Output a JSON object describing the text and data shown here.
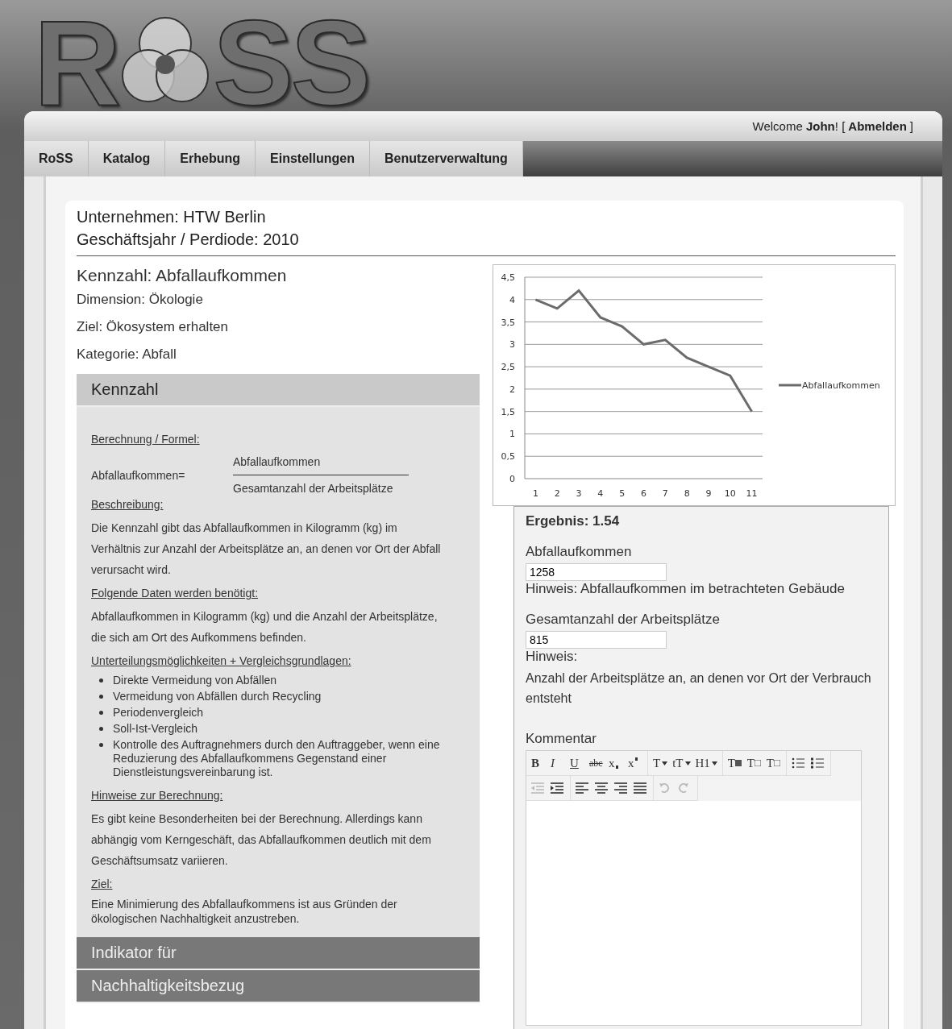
{
  "logo": {
    "before": "R",
    "after": "SS"
  },
  "user_bar": {
    "welcome": "Welcome **John**! [",
    "logout": "Abmelden",
    "close": "]"
  },
  "nav": [
    {
      "label": "RoSS",
      "selected": false
    },
    {
      "label": "Katalog",
      "selected": false
    },
    {
      "label": "Erhebung",
      "selected": false
    },
    {
      "label": "Einstellungen",
      "selected": false
    },
    {
      "label": "Benutzerverwaltung",
      "selected": false
    }
  ],
  "header": {
    "company": "Unternehmen: HTW Berlin",
    "period": "Geschäftsjahr / Perdiode: 2010"
  },
  "metric": {
    "title": "Kennzahl: Abfallaufkommen",
    "dimension": "Dimension: Ökologie",
    "goal": "Ziel: Ökosystem erhalten",
    "category": "Kategorie: Abfall"
  },
  "accordion": [
    {
      "title": "Kennzahl",
      "expanded": true
    },
    {
      "title": "Indikator für",
      "expanded": false
    },
    {
      "title": "Nachhaltigkeitsbezug",
      "expanded": false
    }
  ],
  "details": {
    "formula_heading": "Berechnung / Formel:",
    "formula_lhs": "Abfallaufkommen=",
    "numerator": "Abfallaufkommen",
    "denominator": "Gesamtanzahl der Arbeitsplätze",
    "description_heading": "Beschreibung:",
    "description": "Die Kennzahl gibt das Abfallaufkommen in Kilogramm (kg) im Verhältnis zur Anzahl der Arbeitsplätze an, an denen vor Ort der Abfall verursacht wird.",
    "data_heading": "Folgende Daten werden benötigt:",
    "data": "Abfallaufkommen in Kilogramm (kg) und die Anzahl der Arbeitsplätze, die sich am Ort des Aufkommens befinden.",
    "options_heading": "Unterteilungsmöglichkeiten + Vergleichsgrundlagen:",
    "options": [
      "Direkte Vermeidung von Abfällen",
      "Vermeidung von Abfällen durch Recycling",
      "Periodenvergleich",
      "Soll-Ist-Vergleich",
      "Kontrolle des Auftragnehmers durch den Auftraggeber, wenn eine Reduzierung des Abfallaufkommens Gegenstand einer Dienstleistungsvereinbarung ist."
    ],
    "notes_heading": "Hinweise zur Berechnung:",
    "notes": "Es gibt keine Besonderheiten bei der Berechnung. Allerdings kann abhängig vom Kerngeschäft, das Abfallaufkommen deutlich mit dem Geschäftsumsatz variieren.",
    "goal_heading": "Ziel:",
    "goal": "Eine Minimierung des Abfallaufkommens ist aus Gründen der ökologischen Nachhaltigkeit anzustreben."
  },
  "chart_data": {
    "type": "line",
    "x": [
      1,
      2,
      3,
      4,
      5,
      6,
      7,
      8,
      9,
      10,
      11
    ],
    "xlim": [
      0.5,
      11.5
    ],
    "ylim": [
      0,
      4.5
    ],
    "grid": true,
    "yticks": [
      {
        "value": 0,
        "label": "0"
      },
      {
        "value": 0.5,
        "label": "0,5"
      },
      {
        "value": 1,
        "label": "1"
      },
      {
        "value": 1.5,
        "label": "1,5"
      },
      {
        "value": 2,
        "label": "2"
      },
      {
        "value": 2.5,
        "label": "2,5"
      },
      {
        "value": 3,
        "label": "3"
      },
      {
        "value": 3.5,
        "label": "3,5"
      },
      {
        "value": 4,
        "label": "4"
      },
      {
        "value": 4.5,
        "label": "4,5"
      }
    ],
    "xticks": [
      1,
      2,
      3,
      4,
      5,
      6,
      7,
      8,
      9,
      10,
      11
    ],
    "series": [
      {
        "name": "Abfallaufkommen",
        "color": "#6b6b6b",
        "values": [
          4,
          3.8,
          4.2,
          3.6,
          3.4,
          3,
          3.1,
          2.7,
          2.5,
          2.3,
          1.5
        ]
      }
    ]
  },
  "result": {
    "title": "Ergebnis: 1.54",
    "fields": [
      {
        "label": "Abfallaufkommen",
        "value": "1258",
        "hint": "Hinweis: Abfallaufkommen im betrachteten Gebäude"
      },
      {
        "label": "Gesamtanzahl der Arbeitsplätze",
        "value": "815",
        "hint": "Hinweis:",
        "note": "Anzahl der Arbeitsplätze an, an denen vor Ort der Verbrauch entsteht"
      }
    ],
    "comment_label": "Kommentar",
    "toolbar": [
      [
        {
          "kind": "bold",
          "label": "B",
          "disabled": false
        },
        {
          "kind": "italic",
          "label": "I",
          "disabled": false
        },
        {
          "kind": "underline",
          "label": "U",
          "disabled": false
        },
        {
          "kind": "strike",
          "label": "abc",
          "disabled": false
        },
        {
          "kind": "sub",
          "label": "x",
          "disabled": false
        },
        {
          "kind": "sup",
          "label": "x",
          "disabled": false
        }
      ],
      [
        {
          "kind": "dropdown",
          "label": "T",
          "disabled": false
        },
        {
          "kind": "dropdown",
          "label": "tT",
          "disabled": false
        },
        {
          "kind": "dropdown",
          "label": "H1",
          "disabled": false
        }
      ],
      [
        {
          "kind": "bgcolor",
          "label": "T",
          "disabled": false
        },
        {
          "kind": "eraser",
          "label": "T",
          "disabled": false
        },
        {
          "kind": "clear",
          "label": "T",
          "disabled": false
        }
      ],
      [
        {
          "kind": "bullets",
          "disabled": false
        },
        {
          "kind": "numbers",
          "disabled": false
        }
      ],
      [
        {
          "kind": "outdent",
          "disabled": true
        },
        {
          "kind": "indent",
          "disabled": false
        }
      ],
      [
        {
          "kind": "align-left",
          "disabled": false
        },
        {
          "kind": "align-center",
          "disabled": false
        },
        {
          "kind": "align-right",
          "disabled": false
        },
        {
          "kind": "justify",
          "disabled": false
        }
      ],
      [
        {
          "kind": "undo",
          "disabled": true
        },
        {
          "kind": "redo",
          "disabled": true
        }
      ]
    ]
  }
}
